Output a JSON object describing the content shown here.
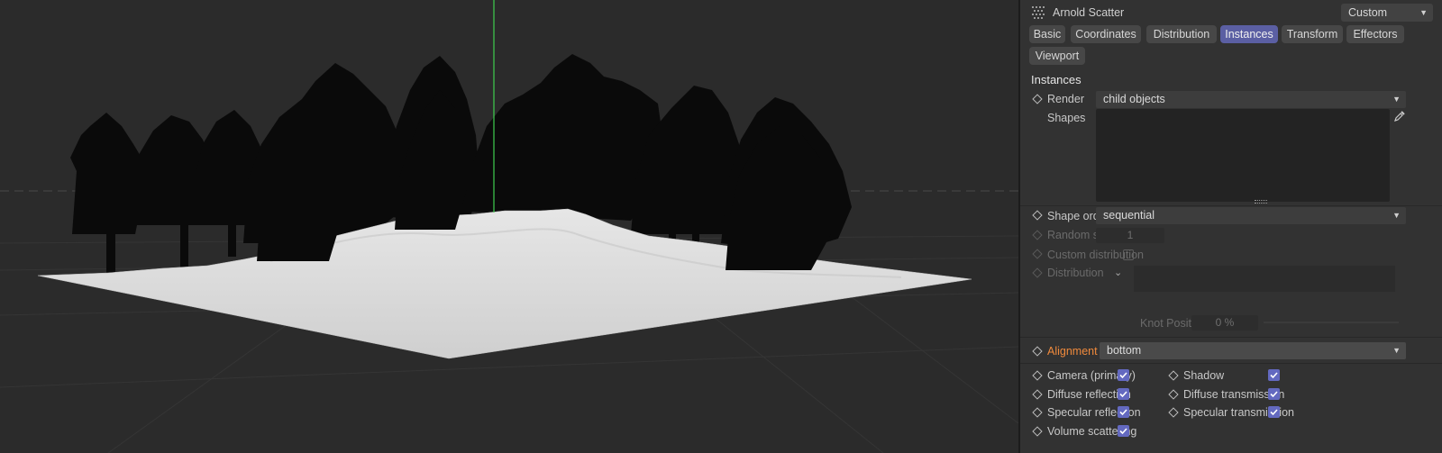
{
  "panel": {
    "title": "Arnold Scatter",
    "preset": "Custom",
    "tabs": [
      {
        "label": "Basic",
        "active": false
      },
      {
        "label": "Coordinates",
        "active": false
      },
      {
        "label": "Distribution",
        "active": false
      },
      {
        "label": "Instances",
        "active": true
      },
      {
        "label": "Transform",
        "active": false
      },
      {
        "label": "Effectors",
        "active": false
      },
      {
        "label": "Viewport",
        "active": false
      }
    ],
    "section_title": "Instances",
    "render": {
      "label": "Render",
      "value": "child objects"
    },
    "shapes": {
      "label": "Shapes"
    },
    "shape_order": {
      "label": "Shape order",
      "value": "sequential"
    },
    "random_seed": {
      "label": "Random seed",
      "value": "1"
    },
    "custom_distribution": {
      "label": "Custom distribution"
    },
    "distribution": {
      "label": "Distribution"
    },
    "knot_position": {
      "label": "Knot Position",
      "value": "0 %"
    },
    "alignment": {
      "label": "Alignment",
      "value": "bottom"
    },
    "visibility": {
      "camera_primary": "Camera (primary)",
      "shadow": "Shadow",
      "diffuse_reflection": "Diffuse reflection",
      "diffuse_transmission": "Diffuse transmission",
      "specular_reflection": "Specular reflection",
      "specular_transmission": "Specular transmission",
      "volume_scattering": "Volume scattering"
    }
  },
  "colors": {
    "accent": "#5b5fa3",
    "checkbox": "#6369c0",
    "alignment_label": "#f08a3c",
    "y_axis": "#3fcf4f"
  }
}
